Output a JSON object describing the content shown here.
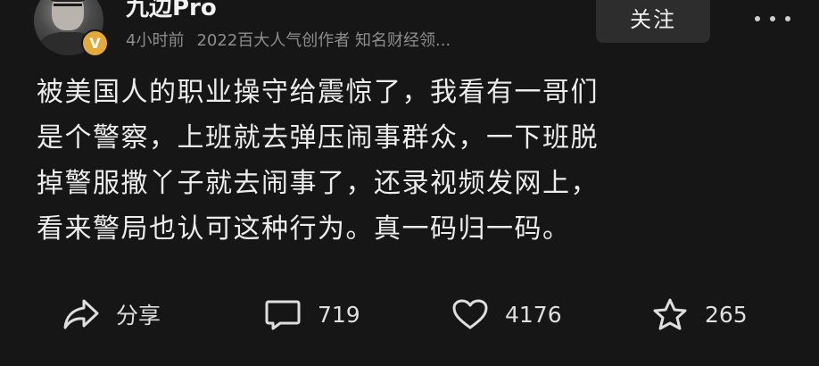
{
  "author": {
    "name": "九边Pro",
    "verified_badge": "V",
    "time": "4小时前",
    "title": "2022百大人气创作者 知名财经领..."
  },
  "follow_button": "关注",
  "post": {
    "lines": [
      "被美国人的职业操守给震惊了，我看有一哥们",
      "是个警察，上班就去弹压闹事群众，一下班脱",
      "掉警服撒丫子就去闹事了，还录视频发网上，",
      "看来警局也认可这种行为。真一码归一码。"
    ]
  },
  "actions": {
    "share": {
      "icon": "share-icon",
      "label": "分享"
    },
    "comment": {
      "icon": "comment-icon",
      "count": "719"
    },
    "like": {
      "icon": "heart-icon",
      "count": "4176"
    },
    "favorite": {
      "icon": "star-icon",
      "count": "265"
    }
  },
  "colors": {
    "background": "#161616",
    "text": "#ececec",
    "muted": "#8d8d8d",
    "badge": "#e2a93b",
    "button_bg": "#2d2d2d"
  }
}
